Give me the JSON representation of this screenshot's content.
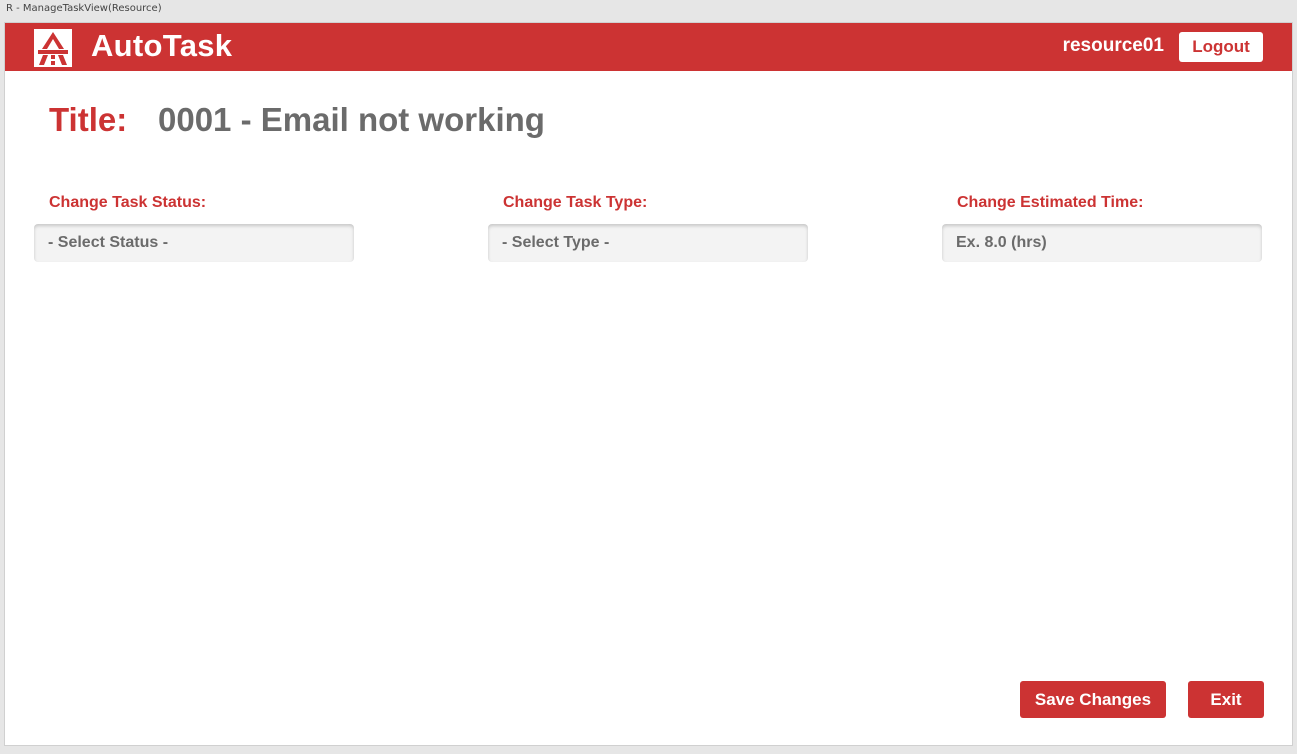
{
  "window": {
    "title": "R - ManageTaskView(Resource)"
  },
  "header": {
    "app_name": "AutoTask",
    "logo_icon": "autotask-logo-icon",
    "username": "resource01",
    "logout_label": "Logout"
  },
  "task": {
    "title_label": "Title:",
    "title_value": "0001 - Email not working"
  },
  "fields": {
    "status": {
      "label": "Change Task Status:",
      "selected": "- Select Status -"
    },
    "type": {
      "label": "Change Task Type:",
      "selected": "- Select Type -"
    },
    "estimated_time": {
      "label": "Change Estimated Time:",
      "placeholder": "Ex. 8.0 (hrs)"
    }
  },
  "actions": {
    "save_label": "Save Changes",
    "exit_label": "Exit"
  },
  "colors": {
    "brand": "#cc3333",
    "text_gray": "#6b6b6b",
    "field_bg": "#f3f3f3"
  }
}
